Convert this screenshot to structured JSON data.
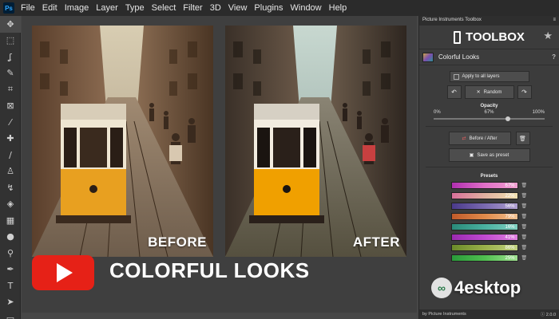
{
  "menu": [
    "File",
    "Edit",
    "Image",
    "Layer",
    "Type",
    "Select",
    "Filter",
    "3D",
    "View",
    "Plugins",
    "Window",
    "Help"
  ],
  "app_logo": "Ps",
  "tools": [
    {
      "name": "move-tool-icon",
      "glyph": "✥"
    },
    {
      "name": "marquee-tool-icon",
      "glyph": "⬚"
    },
    {
      "name": "lasso-tool-icon",
      "glyph": "ʆ"
    },
    {
      "name": "quick-select-tool-icon",
      "glyph": "✎"
    },
    {
      "name": "crop-tool-icon",
      "glyph": "⌗"
    },
    {
      "name": "frame-tool-icon",
      "glyph": "⊠"
    },
    {
      "name": "eyedropper-tool-icon",
      "glyph": "⁄"
    },
    {
      "name": "healing-tool-icon",
      "glyph": "✚"
    },
    {
      "name": "brush-tool-icon",
      "glyph": "∕"
    },
    {
      "name": "stamp-tool-icon",
      "glyph": "♙"
    },
    {
      "name": "history-brush-tool-icon",
      "glyph": "↯"
    },
    {
      "name": "eraser-tool-icon",
      "glyph": "◈"
    },
    {
      "name": "gradient-tool-icon",
      "glyph": "▦"
    },
    {
      "name": "blur-tool-icon",
      "glyph": "●"
    },
    {
      "name": "dodge-tool-icon",
      "glyph": "⚲"
    },
    {
      "name": "pen-tool-icon",
      "glyph": "✒"
    },
    {
      "name": "type-tool-icon",
      "glyph": "T"
    },
    {
      "name": "path-select-tool-icon",
      "glyph": "➤"
    },
    {
      "name": "shape-tool-icon",
      "glyph": "▭"
    }
  ],
  "canvas": {
    "before_label": "BEFORE",
    "after_label": "AFTER",
    "banner": "COLORFUL LOOKS"
  },
  "panel": {
    "tab_title": "Picture Instruments Toolbox",
    "title": "TOOLBOX",
    "tool_name": "Colorful Looks",
    "apply_all": "Apply to all layers",
    "random": "Random",
    "opacity_label": "Opacity",
    "opacity_min": "0%",
    "opacity_value": "67%",
    "opacity_max": "100%",
    "opacity_fraction": 0.67,
    "before_after": "Before / After",
    "save_preset": "Save as preset",
    "presets_label": "Presets",
    "presets": [
      {
        "pct": "67%",
        "colors": [
          "#b02fb0",
          "#e070c8",
          "#f0a0d0"
        ]
      },
      {
        "pct": "22%",
        "colors": [
          "#d8709a",
          "#e0b0a0",
          "#f0e0b0"
        ]
      },
      {
        "pct": "56%",
        "colors": [
          "#4a3a8a",
          "#7a6ab0",
          "#b0a0d0"
        ]
      },
      {
        "pct": "79%",
        "colors": [
          "#c05a2a",
          "#e08a4a",
          "#f0c090"
        ]
      },
      {
        "pct": "16%",
        "colors": [
          "#2a8a7a",
          "#4ab0a0",
          "#80d0c0"
        ]
      },
      {
        "pct": "41%",
        "colors": [
          "#9a2ab0",
          "#c04ad0",
          "#e080e0"
        ]
      },
      {
        "pct": "86%",
        "colors": [
          "#6a8a2a",
          "#9ab04a",
          "#c0d080"
        ]
      },
      {
        "pct": "25%",
        "colors": [
          "#2a9a3a",
          "#50c050",
          "#a0e090"
        ]
      }
    ],
    "footer_left": "by Picture Instruments",
    "footer_right": "2.0.0"
  },
  "watermark": {
    "text": "4esktop",
    "icon_glyph": "∞"
  }
}
